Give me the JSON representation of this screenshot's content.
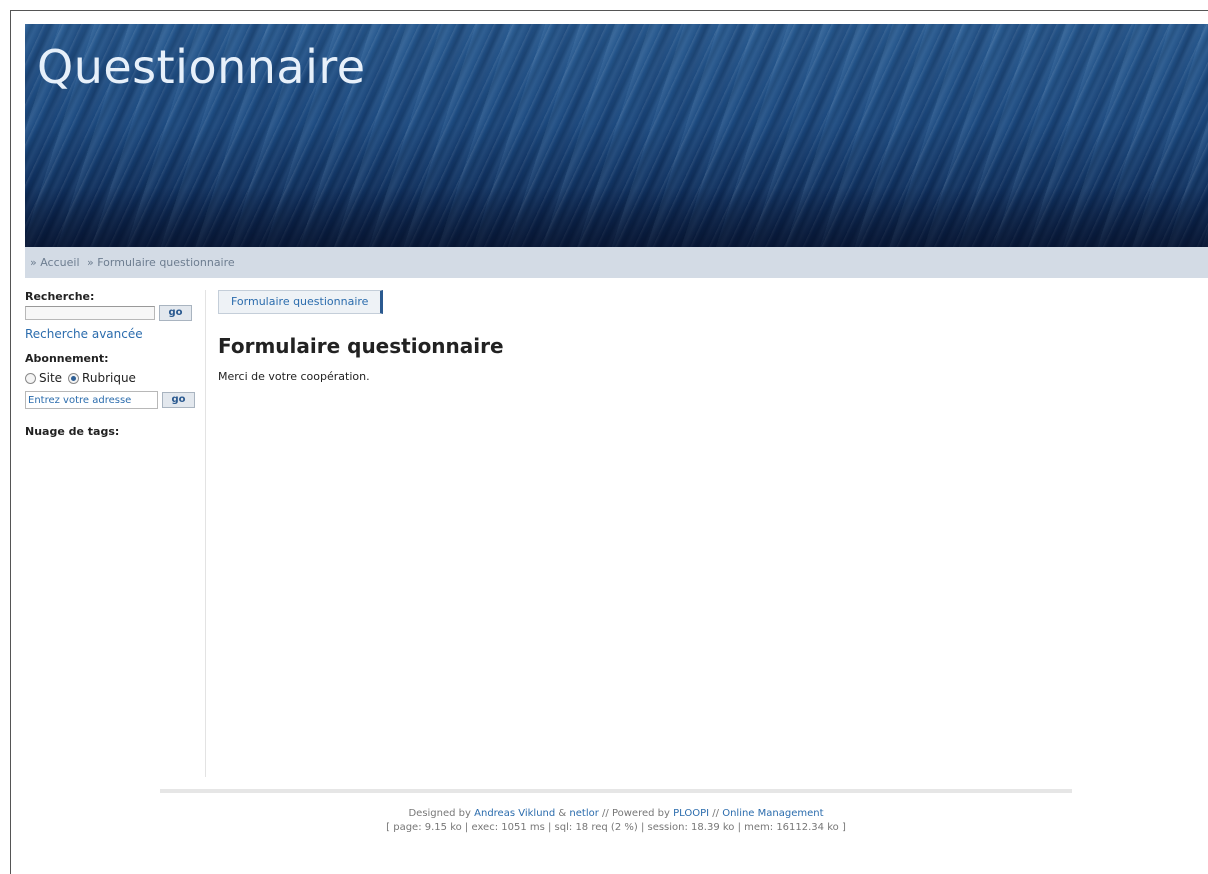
{
  "header": {
    "title": "Questionnaire"
  },
  "breadcrumb": {
    "items": [
      "» Accueil",
      "» Formulaire questionnaire"
    ]
  },
  "sidebar": {
    "search_label": "Recherche:",
    "search_value": "",
    "go_label": "go",
    "advanced_search_link": "Recherche avancée",
    "subscription_label": "Abonnement:",
    "radio_options": [
      {
        "label": "Site",
        "checked": false
      },
      {
        "label": "Rubrique",
        "checked": true
      }
    ],
    "email_placeholder": "Entrez votre adresse",
    "email_go_label": "go",
    "tags_label": "Nuage de tags:"
  },
  "main": {
    "tab_label": "Formulaire questionnaire",
    "heading": "Formulaire questionnaire",
    "message": "Merci de votre coopération."
  },
  "footer": {
    "designed_by": "Designed by",
    "author1": "Andreas Viklund",
    "amp": "&",
    "author2": "netlor",
    "powered_by": "// Powered by",
    "powered_link": "PLOOPI",
    "sep": "//",
    "management_link": "Online Management",
    "stats": "[ page: 9.15 ko | exec: 1051 ms | sql: 18 req (2 %) | session: 18.39 ko | mem: 16112.34 ko ]"
  },
  "colors": {
    "header_blue": "#1c4a80",
    "link": "#2b6cad",
    "breadcrumb_bg": "#d3dbe5"
  }
}
